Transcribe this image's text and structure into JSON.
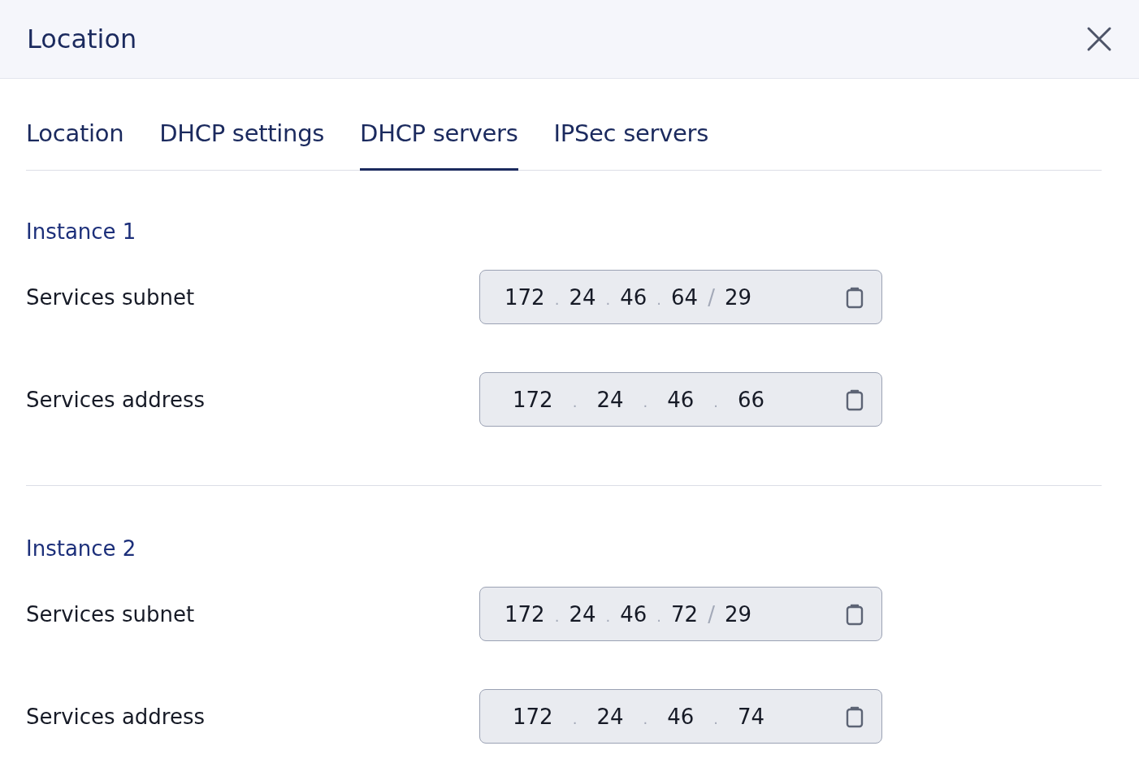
{
  "header": {
    "title": "Location"
  },
  "tabs": [
    {
      "label": "Location",
      "selected": false
    },
    {
      "label": "DHCP settings",
      "selected": false
    },
    {
      "label": "DHCP servers",
      "selected": true
    },
    {
      "label": "IPSec servers",
      "selected": false
    }
  ],
  "instances": [
    {
      "title": "Instance 1",
      "fields": [
        {
          "label": "Services subnet",
          "kind": "subnet",
          "parts": [
            "172",
            ".",
            "24",
            ".",
            "46",
            ".",
            "64",
            "/",
            "29"
          ]
        },
        {
          "label": "Services address",
          "kind": "address",
          "parts": [
            "172",
            ".",
            "24",
            ".",
            "46",
            ".",
            "66"
          ]
        }
      ]
    },
    {
      "title": "Instance 2",
      "fields": [
        {
          "label": "Services subnet",
          "kind": "subnet",
          "parts": [
            "172",
            ".",
            "24",
            ".",
            "46",
            ".",
            "72",
            "/",
            "29"
          ]
        },
        {
          "label": "Services address",
          "kind": "address",
          "parts": [
            "172",
            ".",
            "24",
            ".",
            "46",
            ".",
            "74"
          ]
        }
      ]
    }
  ]
}
